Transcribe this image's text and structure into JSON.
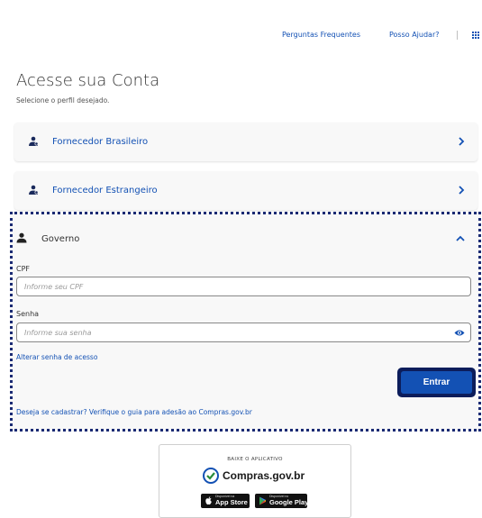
{
  "header": {
    "faq_label": "Perguntas Frequentes",
    "help_label": "Posso Ajudar?"
  },
  "page": {
    "title": "Acesse sua Conta",
    "subtitle": "Selecione o perfil desejado."
  },
  "profiles": [
    {
      "label": "Fornecedor Brasileiro"
    },
    {
      "label": "Fornecedor Estrangeiro"
    }
  ],
  "governo": {
    "label": "Governo",
    "cpf_label": "CPF",
    "cpf_placeholder": "Informe seu CPF",
    "senha_label": "Senha",
    "senha_placeholder": "Informe sua senha",
    "change_password_link": "Alterar senha de acesso",
    "submit_label": "Entrar",
    "register_text": "Deseja se cadastrar? Verifique o guia para adesão ao Compras.gov.br"
  },
  "app_promo": {
    "caption": "BAIXE O APLICATIVO",
    "brand_name": "Compras",
    "brand_domain": ".gov.br",
    "appstore_small": "Disponível na",
    "appstore_label": "App Store",
    "googleplay_small": "Disponível no",
    "googleplay_label": "Google Play"
  },
  "colors": {
    "link_blue": "#1351b4",
    "focus_navy": "#0c1d5b",
    "card_bg": "#f8f8f8"
  },
  "icons": [
    "grid-icon",
    "user-group-icon",
    "user-icon",
    "chevron-right-icon",
    "chevron-up-icon",
    "eye-icon",
    "compras-logo-icon",
    "apple-icon",
    "google-play-icon"
  ]
}
